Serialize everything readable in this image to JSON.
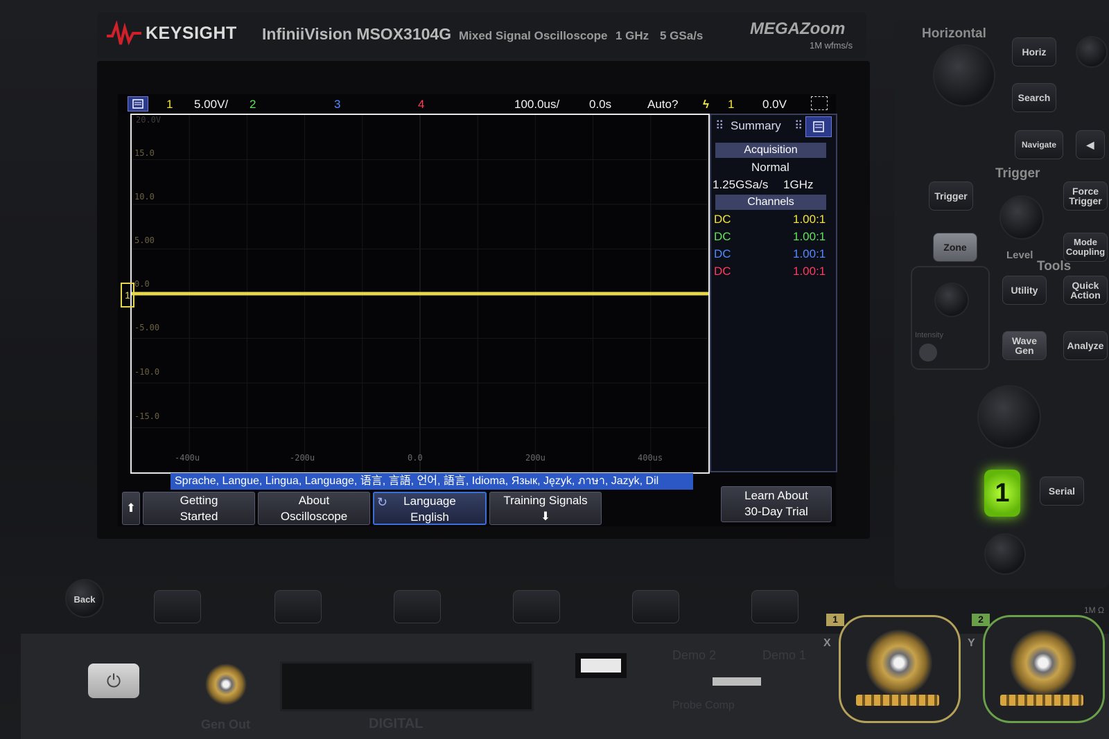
{
  "header": {
    "brand": "KEYSIGHT",
    "model": "InfiniiVision MSOX3104G",
    "description": "Mixed Signal Oscilloscope",
    "bandwidth": "1 GHz",
    "sample_rate": "5 GSa/s",
    "megazoom": "MEGAZoom",
    "megazoom_sub": "1M wfms/s"
  },
  "status_bar": {
    "ch1": "1",
    "ch1_scale": "5.00V/",
    "ch2": "2",
    "ch3": "3",
    "ch4": "4",
    "timebase": "100.0us/",
    "delay": "0.0s",
    "trigger_mode": "Auto?",
    "trigger_source": "1",
    "trigger_level": "0.0V"
  },
  "plot": {
    "y_ticks": [
      "20.0V",
      "15.0",
      "10.0",
      "5.00",
      "0.0",
      "-5.00",
      "-10.0",
      "-15.0"
    ],
    "x_ticks": [
      "-400u",
      "-200u",
      "0.0",
      "200u",
      "400us"
    ],
    "ground_marker": "1",
    "trace_level_v": 0.0,
    "trace_color": "#e6d84a"
  },
  "side_panel": {
    "tab": "Summary",
    "acquisition_header": "Acquisition",
    "acquisition_mode": "Normal",
    "sample_rate": "1.25GSa/s",
    "bandwidth": "1GHz",
    "channels_header": "Channels",
    "channels": [
      {
        "coupling": "DC",
        "probe": "1.00:1",
        "color": "#f2e43a"
      },
      {
        "coupling": "DC",
        "probe": "1.00:1",
        "color": "#5fe35a"
      },
      {
        "coupling": "DC",
        "probe": "1.00:1",
        "color": "#4f8bff"
      },
      {
        "coupling": "DC",
        "probe": "1.00:1",
        "color": "#ff3a5a"
      }
    ]
  },
  "language_banner": "Sprache, Langue, Lingua, Language, 语言, 言語, 언어, 語言, Idioma, Язык, Język, ภาษา, Jazyk, Dil",
  "softkeys": {
    "getting_started_1": "Getting",
    "getting_started_2": "Started",
    "about_1": "About",
    "about_2": "Oscilloscope",
    "language_1": "Language",
    "language_2": "English",
    "training": "Training Signals",
    "learn_1": "Learn About",
    "learn_2": "30-Day Trial"
  },
  "front_panel": {
    "horizontal": "Horizontal",
    "horiz": "Horiz",
    "search": "Search",
    "navigate": "Navigate",
    "trigger_section": "Trigger",
    "trigger": "Trigger",
    "force_trigger_1": "Force",
    "force_trigger_2": "Trigger",
    "zone": "Zone",
    "level": "Level",
    "mode_coupling_1": "Mode",
    "mode_coupling_2": "Coupling",
    "tools": "Tools",
    "utility": "Utility",
    "quick_action_1": "Quick",
    "quick_action_2": "Action",
    "wave_gen_1": "Wave",
    "wave_gen_2": "Gen",
    "analyze": "Analyze",
    "channel_1": "1",
    "serial": "Serial",
    "back": "Back",
    "intensity": "Intensity",
    "gen_out": "Gen Out",
    "digital": "DIGITAL",
    "demo2": "Demo 2",
    "demo1": "Demo 1",
    "probe_comp": "Probe Comp",
    "input_x": "X",
    "input_y": "Y",
    "input1_label": "1",
    "input2_label": "2",
    "impedance": "1M Ω"
  }
}
